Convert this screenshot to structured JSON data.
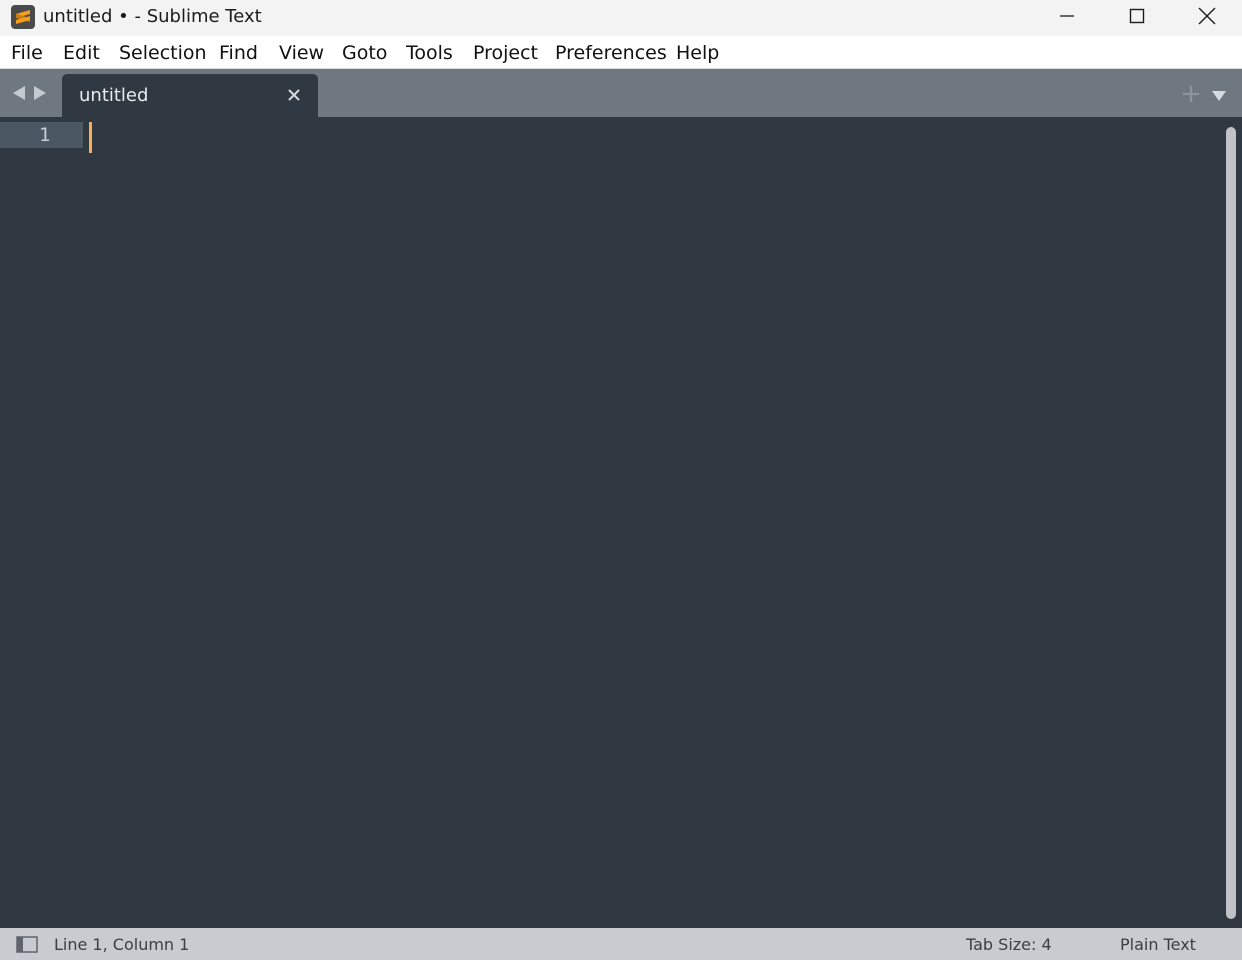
{
  "window": {
    "title": "untitled • - Sublime Text",
    "app_icon": "sublime-text-logo",
    "controls": [
      "minimize-icon",
      "maximize-icon",
      "close-icon"
    ]
  },
  "menu": [
    "File",
    "Edit",
    "Selection",
    "Find",
    "View",
    "Goto",
    "Tools",
    "Project",
    "Preferences",
    "Help"
  ],
  "tabs": [
    {
      "label": "untitled",
      "active": true,
      "close_icon": "close-icon"
    }
  ],
  "tabbar_icons": [
    "arrow-left-icon",
    "arrow-right-icon",
    "plus-icon",
    "chevron-down-icon"
  ],
  "editor": {
    "line_numbers": [
      "1"
    ],
    "content": "",
    "theme": {
      "background": "#303841",
      "gutter_highlight": "#4b5763",
      "caret": "#f9ae58"
    }
  },
  "status": {
    "position": "Line 1, Column 1",
    "tab_size": "Tab Size: 4",
    "syntax": "Plain Text"
  }
}
